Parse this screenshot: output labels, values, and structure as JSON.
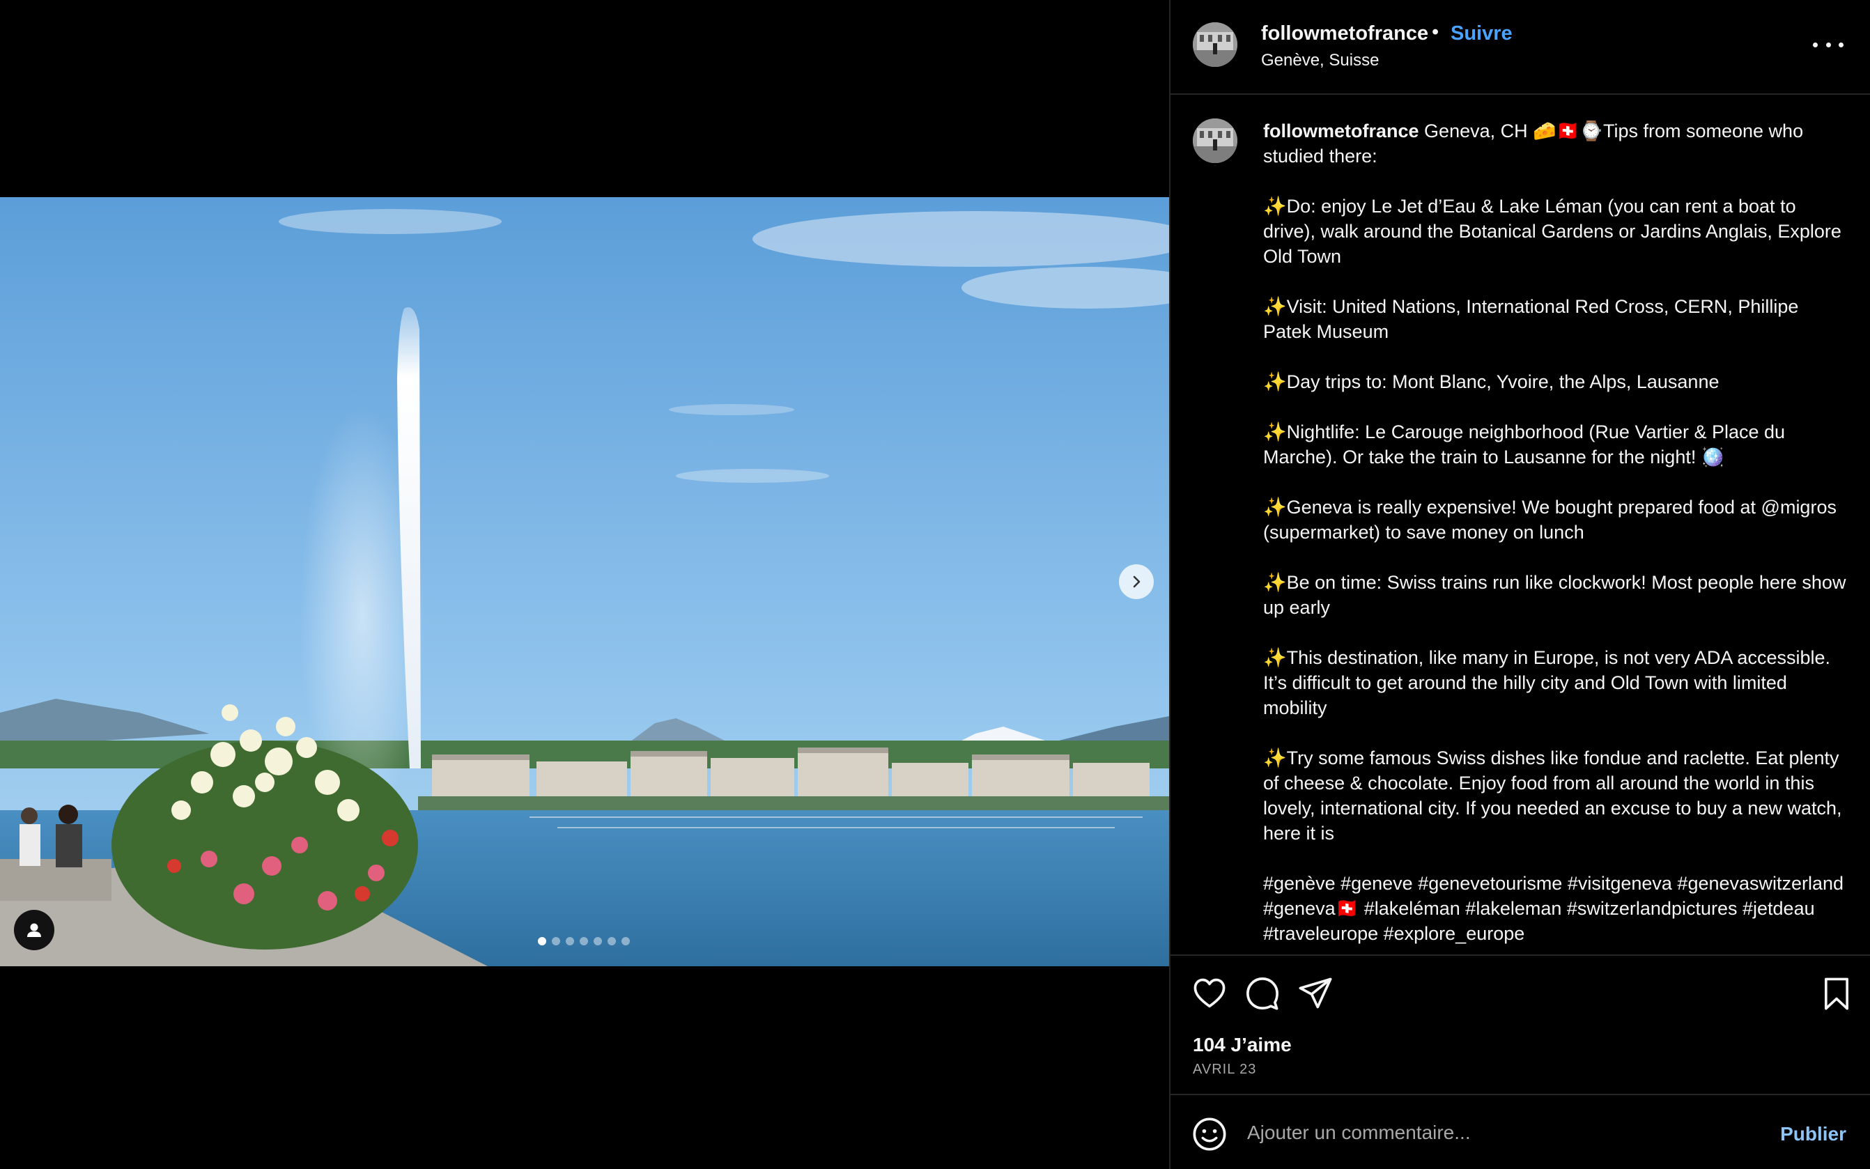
{
  "post": {
    "username": "followmetofrance",
    "separator": "•",
    "follow_label": "Suivre",
    "location": "Genève, Suisse"
  },
  "caption": {
    "username": "followmetofrance",
    "paragraphs": [
      "Geneva, CH 🧀🇨🇭⌚Tips from someone who studied there:",
      "✨Do: enjoy Le Jet d’Eau & Lake Léman (you can rent a boat to drive), walk around the Botanical Gardens or Jardins Anglais, Explore Old Town",
      "✨Visit: United Nations, International Red Cross, CERN, Phillipe Patek Museum",
      "✨Day trips to: Mont Blanc, Yvoire, the Alps, Lausanne",
      "✨Nightlife: Le Carouge neighborhood (Rue Vartier & Place du Marche). Or take the train to Lausanne for the night! 🪩",
      "✨Geneva is really expensive! We bought prepared food at @migros (supermarket) to save money on lunch",
      "✨Be on time: Swiss trains run like clockwork! Most people here show up early",
      "✨This destination, like many in Europe, is not very ADA accessible. It’s difficult to get around the hilly city and Old Town with limited mobility",
      "✨Try some famous Swiss dishes like fondue and raclette. Eat plenty of cheese & chocolate. Enjoy food from all around the world in this lovely, international city. If you needed an excuse to buy a new watch, here it is",
      "#genève #geneve #genevetourisme #visitgeneva #genevaswitzerland #geneva🇨🇭 #lakeléman #lakeleman #switzerlandpictures #jetdeau #traveleurope #explore_europe"
    ]
  },
  "stats": {
    "likes": "104 J’aime",
    "date": "AVRIL 23"
  },
  "comment": {
    "placeholder": "Ajouter un commentaire...",
    "publish_label": "Publier"
  },
  "carousel": {
    "total_slides": 7,
    "current_slide": 1
  },
  "colors": {
    "accent": "#4aa3ff",
    "publish": "#8dc3f5",
    "border": "#262626",
    "muted": "#a8a8a8"
  },
  "icons": [
    "chevron-right-icon",
    "user-tag-icon",
    "more-options-icon",
    "heart-icon",
    "comment-icon",
    "share-icon",
    "bookmark-icon",
    "emoji-icon"
  ]
}
